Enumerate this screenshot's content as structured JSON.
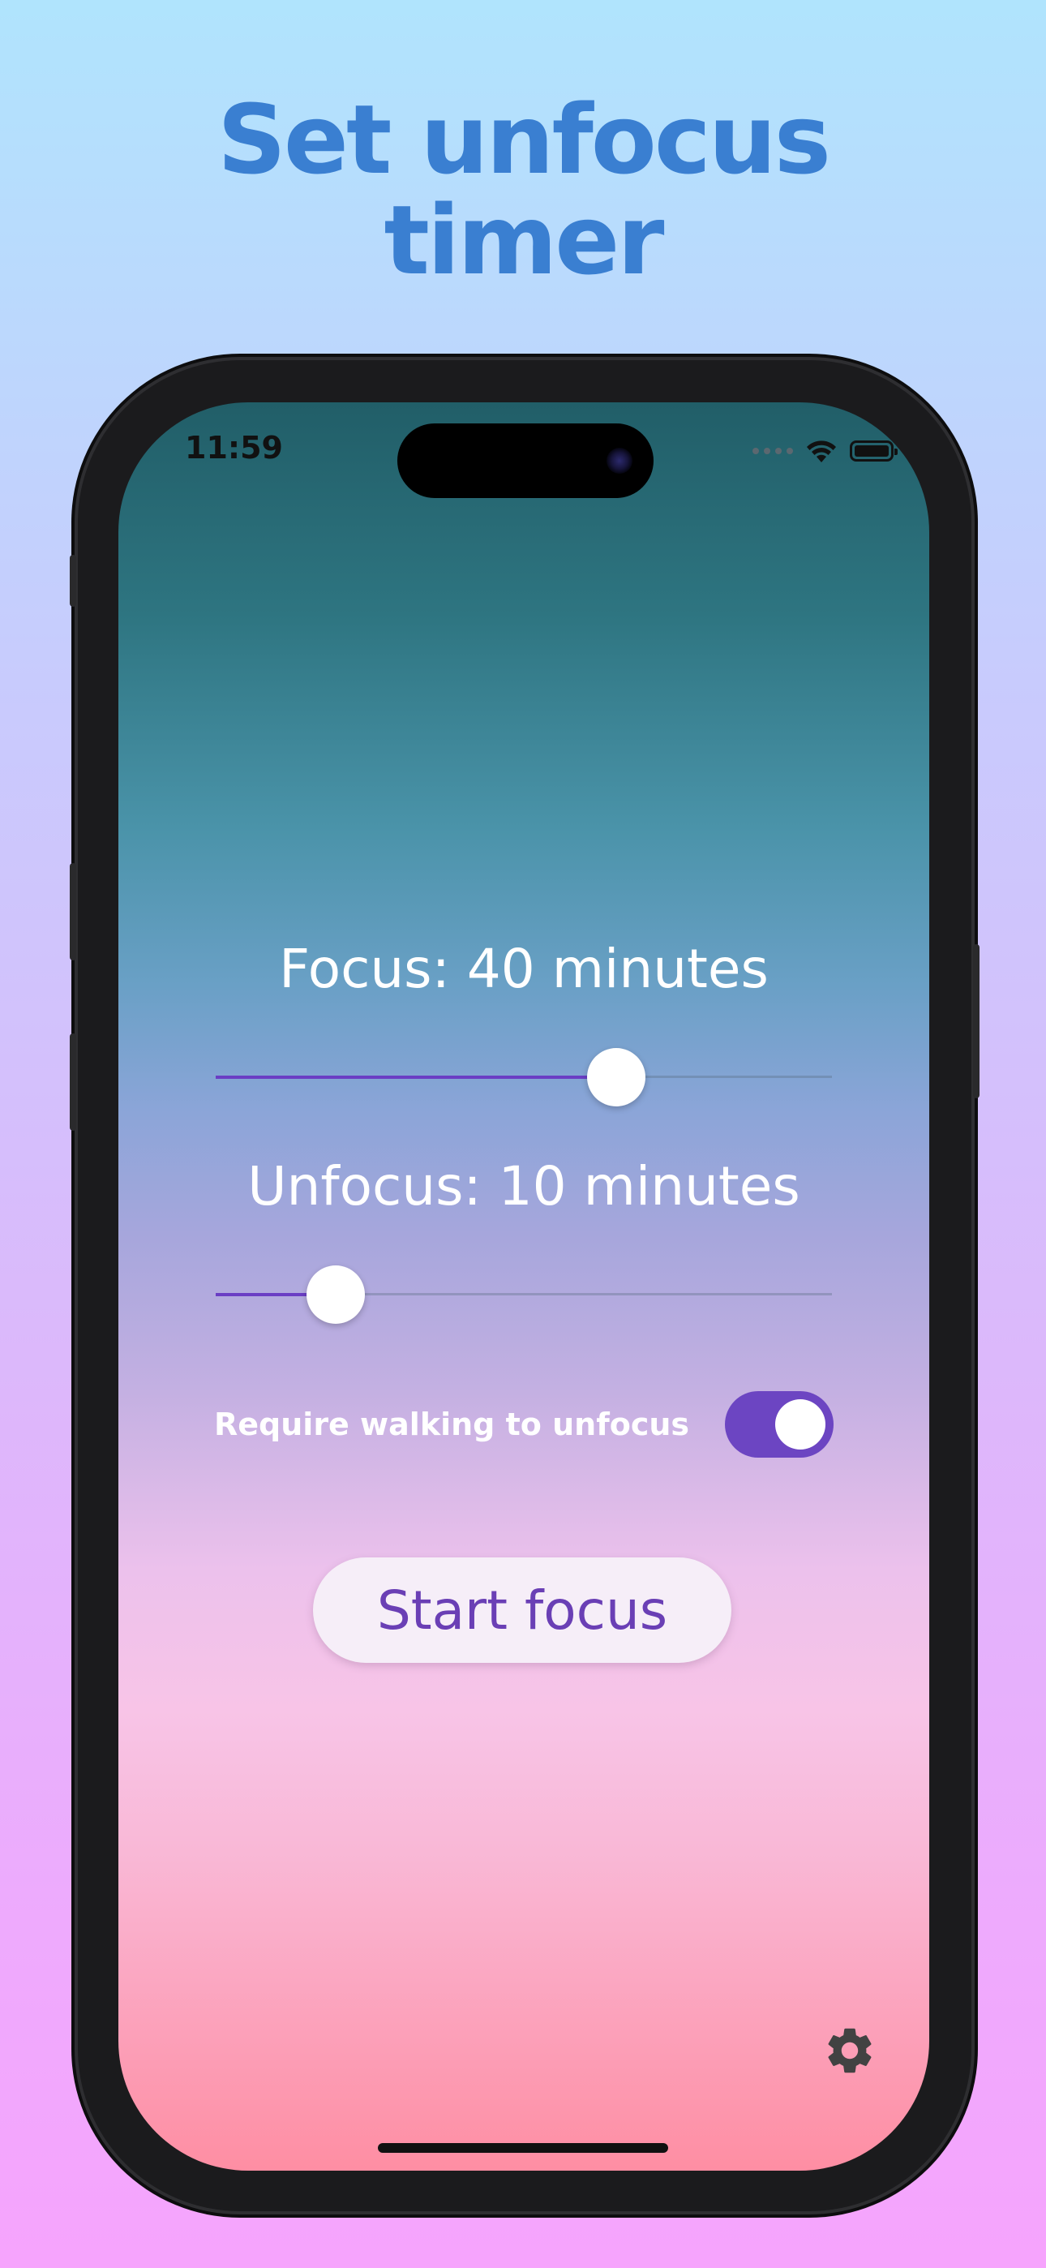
{
  "headline": {
    "line1": "Set unfocus",
    "line2": "timer"
  },
  "status_bar": {
    "time": "11:59",
    "icons": [
      "cellular-dots-icon",
      "wifi-icon",
      "battery-icon"
    ]
  },
  "focus": {
    "label": "Focus: 40 minutes",
    "value_fraction": 0.65
  },
  "unfocus": {
    "label": "Unfocus: 10 minutes",
    "value_fraction": 0.195
  },
  "walking_toggle": {
    "label": "Require walking to unfocus",
    "on": true
  },
  "start_button": {
    "label": "Start focus"
  },
  "settings": {
    "icon": "gear-icon"
  },
  "colors": {
    "headline": "#3a7fd1",
    "accent": "#6a3ec4",
    "button_text": "#6a3fb5"
  }
}
